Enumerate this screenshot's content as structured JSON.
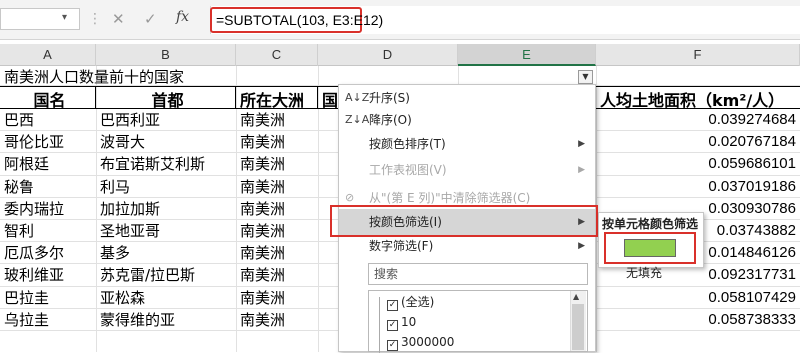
{
  "formula_bar": {
    "dropdown_arrow": "▾",
    "cancel_icon": "✕",
    "enter_icon": "✓",
    "fx_label": "fx",
    "formula": "=SUBTOTAL(103, E3:E12)"
  },
  "columns": [
    "A",
    "B",
    "C",
    "D",
    "E",
    "F"
  ],
  "sheet": {
    "title": "南美洲人口数量前十的国家",
    "headers": [
      "国名",
      "首都",
      "所在大洲",
      "国",
      "",
      "人均土地面积（km²/人）"
    ],
    "rows": [
      {
        "country": "巴西",
        "capital": "巴西利亚",
        "continent": "南美洲",
        "area": "0.039274684"
      },
      {
        "country": "哥伦比亚",
        "capital": "波哥大",
        "continent": "南美洲",
        "area": "0.020767184"
      },
      {
        "country": "阿根廷",
        "capital": "布宜诺斯艾利斯",
        "continent": "南美洲",
        "area": "0.059686101"
      },
      {
        "country": "秘鲁",
        "capital": "利马",
        "continent": "南美洲",
        "area": "0.037019186"
      },
      {
        "country": "委内瑞拉",
        "capital": "加拉加斯",
        "continent": "南美洲",
        "area": "0.030930786"
      },
      {
        "country": "智利",
        "capital": "圣地亚哥",
        "continent": "南美洲",
        "area": "0.03743882"
      },
      {
        "country": "厄瓜多尔",
        "capital": "基多",
        "continent": "南美洲",
        "area": "0.014846126"
      },
      {
        "country": "玻利维亚",
        "capital": "苏克雷/拉巴斯",
        "continent": "南美洲",
        "area": "0.092317731"
      },
      {
        "country": "巴拉圭",
        "capital": "亚松森",
        "continent": "南美洲",
        "area": "0.058107429"
      },
      {
        "country": "乌拉圭",
        "capital": "蒙得维的亚",
        "continent": "南美洲",
        "area": "0.058738333"
      }
    ]
  },
  "filter_menu": {
    "items": [
      {
        "label": "升序(S)",
        "icon": "A↓Z",
        "arrow": false,
        "disabled": false
      },
      {
        "label": "降序(O)",
        "icon": "Z↓A",
        "arrow": false,
        "disabled": false
      },
      {
        "label": "按颜色排序(T)",
        "icon": "",
        "arrow": true,
        "disabled": false
      },
      {
        "label": "工作表视图(V)",
        "icon": "",
        "arrow": true,
        "disabled": true
      },
      {
        "label": "从\"(第 E 列)\"中清除筛选器(C)",
        "icon": "⊘",
        "arrow": false,
        "disabled": true
      },
      {
        "label": "按颜色筛选(I)",
        "icon": "",
        "arrow": true,
        "disabled": false
      },
      {
        "label": "数字筛选(F)",
        "icon": "",
        "arrow": true,
        "disabled": false
      }
    ],
    "search_placeholder": "搜索",
    "list": [
      "(全选)",
      "10",
      "3000000"
    ]
  },
  "color_submenu": {
    "title": "按单元格颜色筛选",
    "swatch_color": "#92d050",
    "no_fill": "无填充"
  }
}
